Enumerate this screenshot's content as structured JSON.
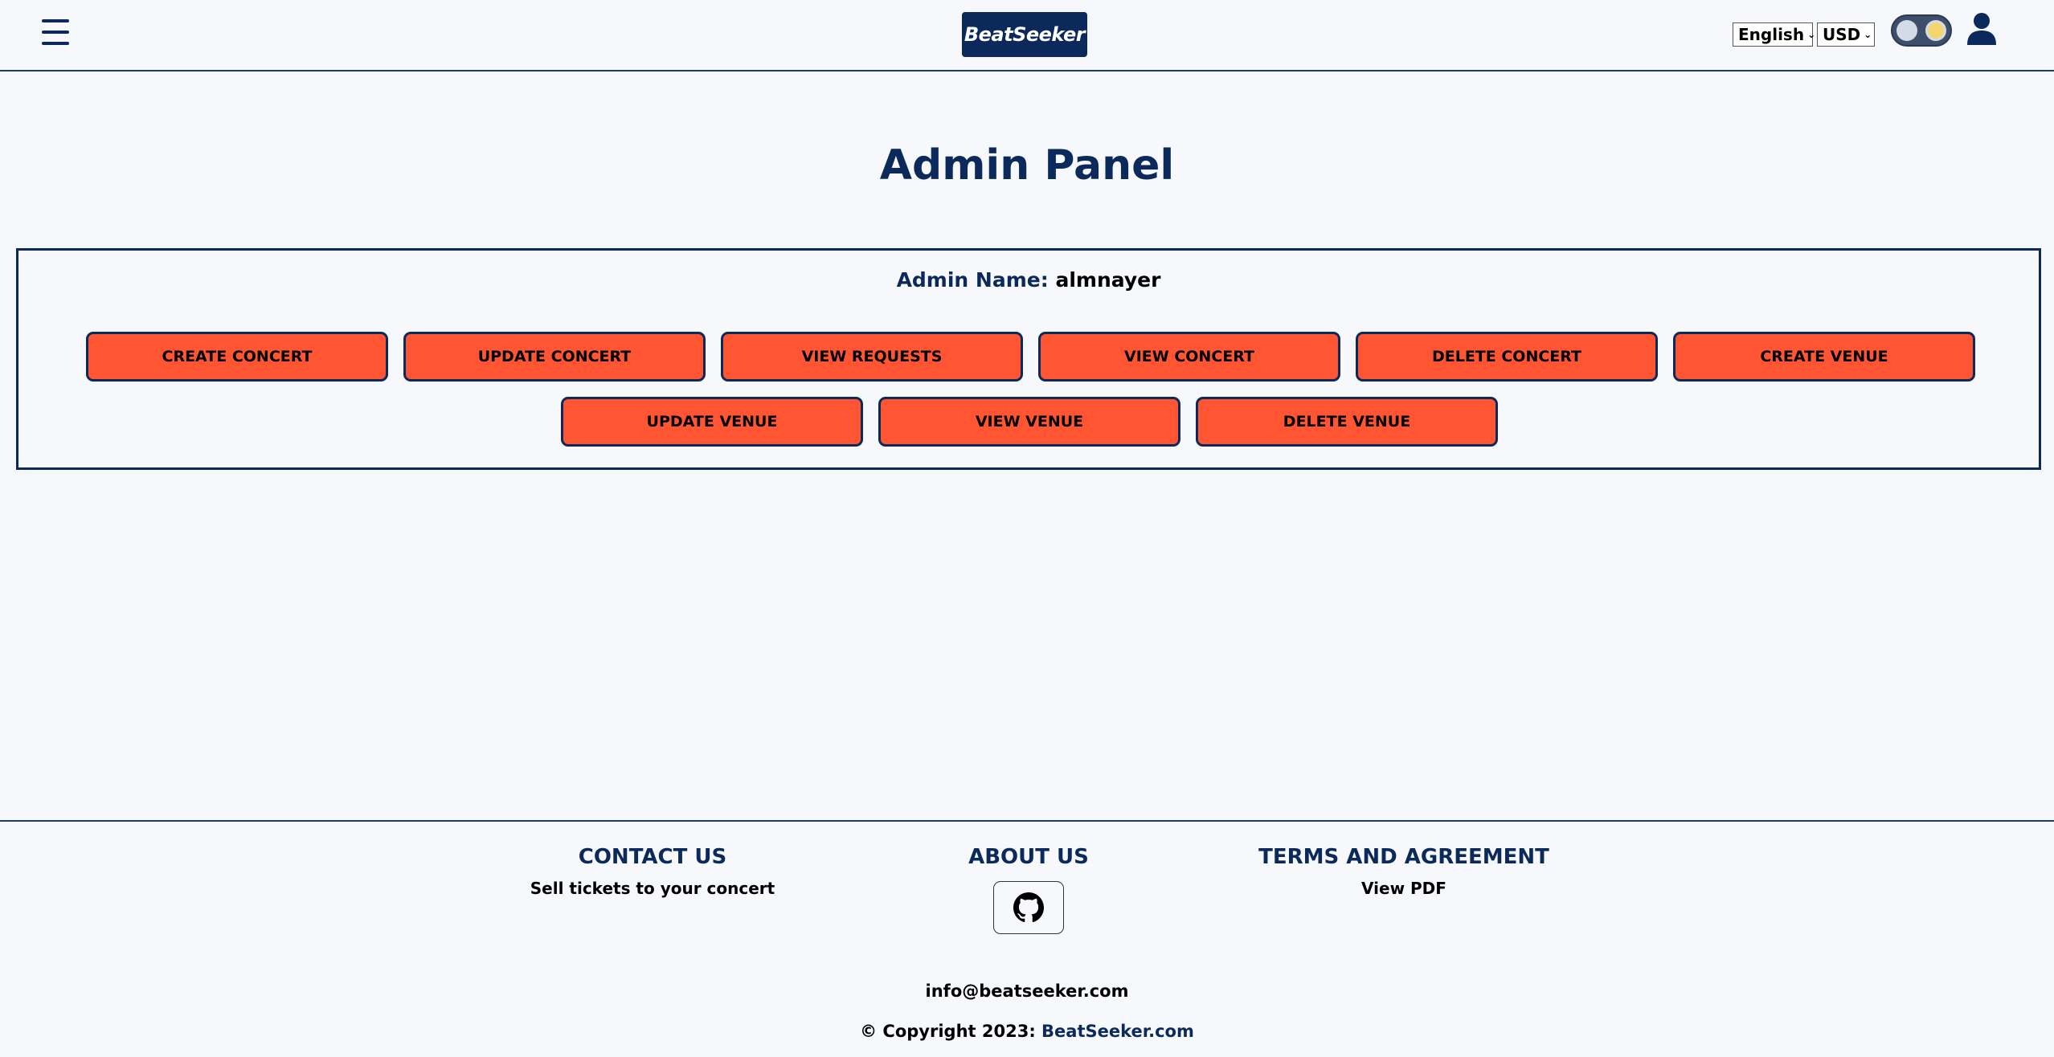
{
  "header": {
    "menu_icon": "hamburger-icon",
    "logo_text": "BeatSeeker",
    "language": "English",
    "currency": "USD",
    "theme_toggle_icon": "theme-toggle-icon",
    "user_icon": "user-icon"
  },
  "main": {
    "title": "Admin Panel",
    "admin_label": "Admin Name:",
    "admin_value": "almnayer",
    "buttons": [
      "CREATE CONCERT",
      "UPDATE CONCERT",
      "VIEW REQUESTS",
      "VIEW CONCERT",
      "DELETE CONCERT",
      "CREATE VENUE",
      "UPDATE VENUE",
      "VIEW VENUE",
      "DELETE VENUE"
    ]
  },
  "footer": {
    "contact_heading": "CONTACT US",
    "contact_text": "Sell tickets to your concert",
    "about_heading": "ABOUT US",
    "about_icon": "github-icon",
    "terms_heading": "TERMS AND AGREEMENT",
    "terms_text": "View PDF",
    "email": "info@beatseeker.com",
    "copyright_prefix": "© Copyright 2023:",
    "copyright_brand": "BeatSeeker.com"
  },
  "colors": {
    "primary": "#0b2a5b",
    "button": "#ff5533",
    "background": "#f6f8fb"
  }
}
